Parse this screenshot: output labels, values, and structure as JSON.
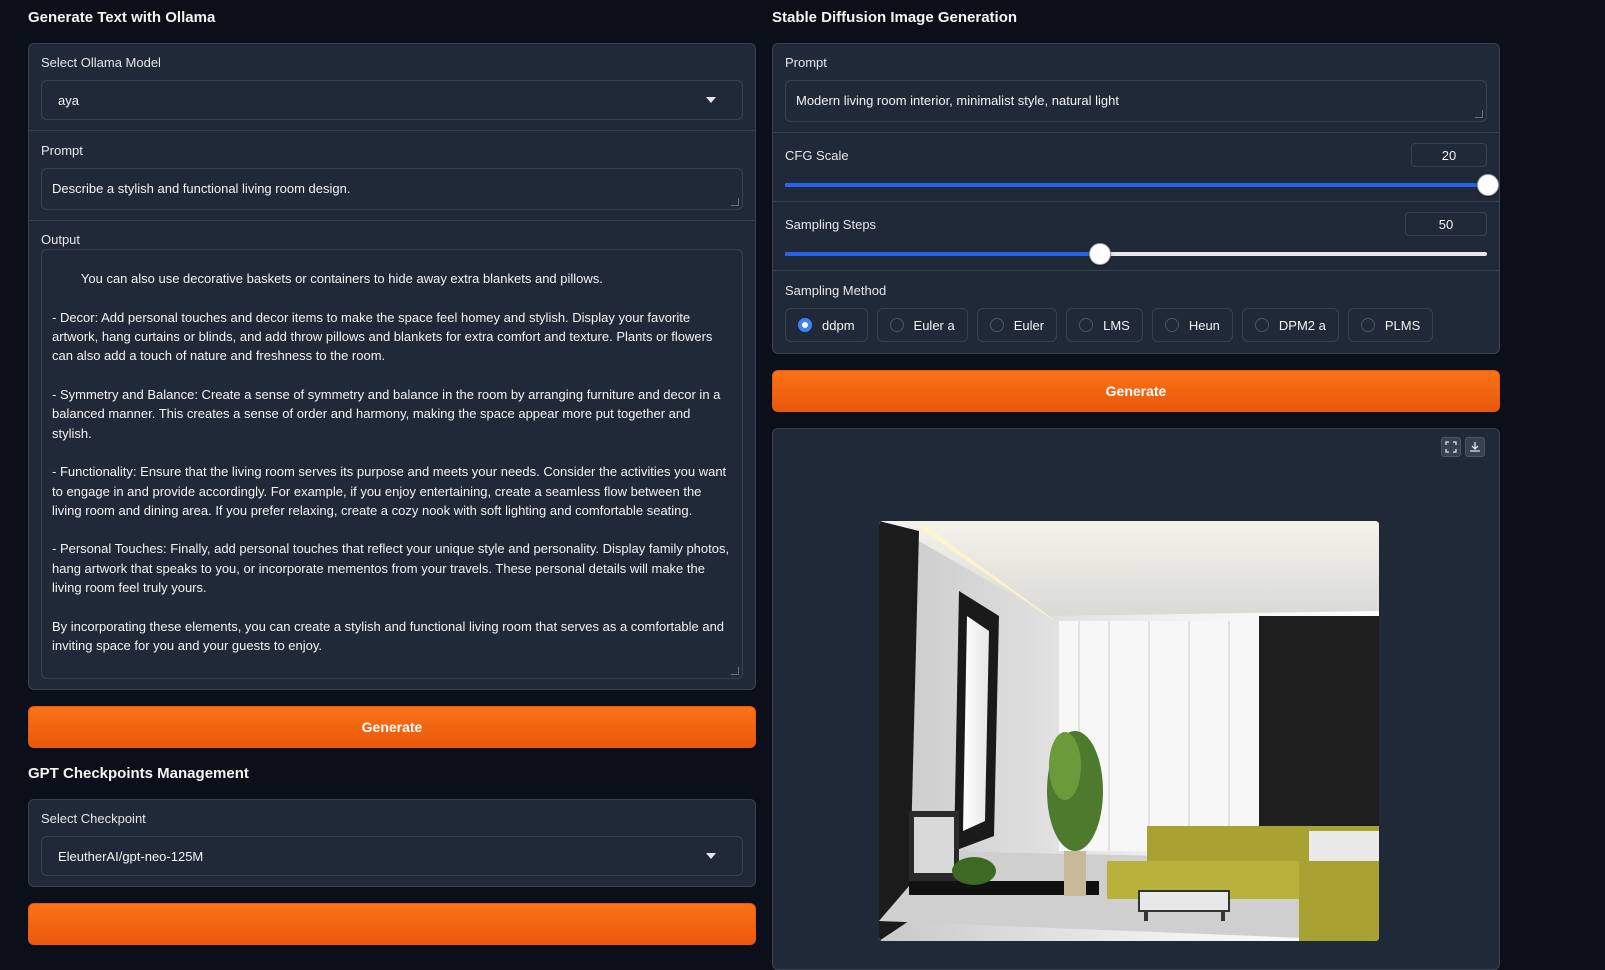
{
  "ollama": {
    "title": "Generate Text with Ollama",
    "model_label": "Select Ollama Model",
    "model_value": "aya",
    "prompt_label": "Prompt",
    "prompt_value": "Describe a stylish and functional living room design.",
    "output_label": "Output",
    "output_text": "You can also use decorative baskets or containers to hide away extra blankets and pillows.\n\n- Decor: Add personal touches and decor items to make the space feel homey and stylish. Display your favorite artwork, hang curtains or blinds, and add throw pillows and blankets for extra comfort and texture. Plants or flowers can also add a touch of nature and freshness to the room.\n\n- Symmetry and Balance: Create a sense of symmetry and balance in the room by arranging furniture and decor in a balanced manner. This creates a sense of order and harmony, making the space appear more put together and stylish.\n\n- Functionality: Ensure that the living room serves its purpose and meets your needs. Consider the activities you want to engage in and provide accordingly. For example, if you enjoy entertaining, create a seamless flow between the living room and dining area. If you prefer relaxing, create a cozy nook with soft lighting and comfortable seating.\n\n- Personal Touches: Finally, add personal touches that reflect your unique style and personality. Display family photos, hang artwork that speaks to you, or incorporate mementos from your travels. These personal details will make the living room feel truly yours.\n\nBy incorporating these elements, you can create a stylish and functional living room that serves as a comfortable and inviting space for you and your guests to enjoy.",
    "generate_label": "Generate"
  },
  "checkpoints": {
    "title": "GPT Checkpoints Management",
    "select_label": "Select Checkpoint",
    "select_value": "EleutherAI/gpt-neo-125M"
  },
  "sd": {
    "title": "Stable Diffusion Image Generation",
    "prompt_label": "Prompt",
    "prompt_value": "Modern living room interior, minimalist style, natural light",
    "cfg_label": "CFG Scale",
    "cfg_value": "20",
    "cfg_fraction": 1.0,
    "steps_label": "Sampling Steps",
    "steps_value": "50",
    "steps_fraction": 0.447,
    "method_label": "Sampling Method",
    "methods": [
      "ddpm",
      "Euler a",
      "Euler",
      "LMS",
      "Heun",
      "DPM2 a",
      "PLMS"
    ],
    "selected_method": "ddpm",
    "generate_label": "Generate"
  },
  "colors": {
    "background": "#0b0f19",
    "panel": "#1f2937",
    "border": "#374151",
    "accent_orange": "#f97316",
    "slider_blue": "#2563eb"
  },
  "icons": {
    "fullscreen": "fullscreen-icon",
    "download": "download-icon",
    "dropdown": "chevron-down-icon"
  }
}
